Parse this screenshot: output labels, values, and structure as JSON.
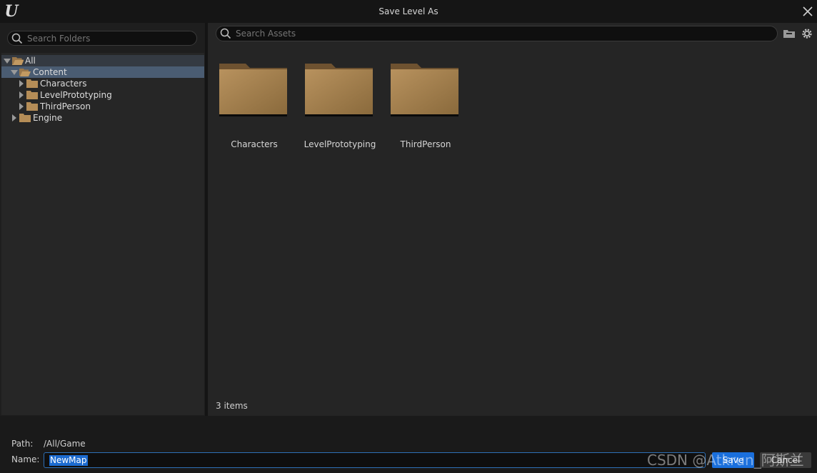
{
  "window": {
    "title": "Save Level As",
    "logo_icon": "unreal-logo-icon",
    "close_icon": "close-icon"
  },
  "folder_panel": {
    "search_placeholder": "Search Folders",
    "tree": [
      {
        "label": "All",
        "expanded": true,
        "selected": false
      },
      {
        "label": "Content",
        "expanded": true,
        "selected": true
      },
      {
        "label": "Characters",
        "expanded": false,
        "selected": false
      },
      {
        "label": "LevelPrototyping",
        "expanded": false,
        "selected": false
      },
      {
        "label": "ThirdPerson",
        "expanded": false,
        "selected": false
      },
      {
        "label": "Engine",
        "expanded": false,
        "selected": false
      }
    ]
  },
  "asset_panel": {
    "search_placeholder": "Search Assets",
    "folders": [
      {
        "label": "Characters"
      },
      {
        "label": "LevelPrototyping"
      },
      {
        "label": "ThirdPerson"
      }
    ],
    "item_count": "3 items"
  },
  "footer": {
    "path_label": "Path:",
    "path_value": "/All/Game",
    "name_label": "Name:",
    "name_value": "NewMap",
    "save_label": "Save",
    "cancel_label": "Cancel"
  },
  "watermark": "CSDN @Atkrun_阿斯兰",
  "colors": {
    "folder": "#a07c4a",
    "selection": "#4a5c72",
    "accent": "#1a6fdc"
  }
}
